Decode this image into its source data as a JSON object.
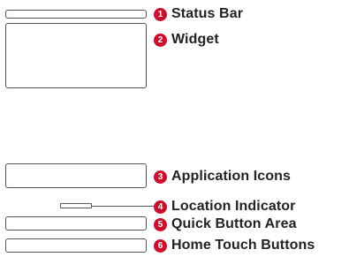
{
  "accent_color": "#c8102e",
  "callouts": [
    {
      "number": "1",
      "label": "Status Bar"
    },
    {
      "number": "2",
      "label": "Widget"
    },
    {
      "number": "3",
      "label": "Application Icons"
    },
    {
      "number": "4",
      "label": "Location Indicator"
    },
    {
      "number": "5",
      "label": "Quick Button Area"
    },
    {
      "number": "6",
      "label": "Home Touch Buttons"
    }
  ]
}
